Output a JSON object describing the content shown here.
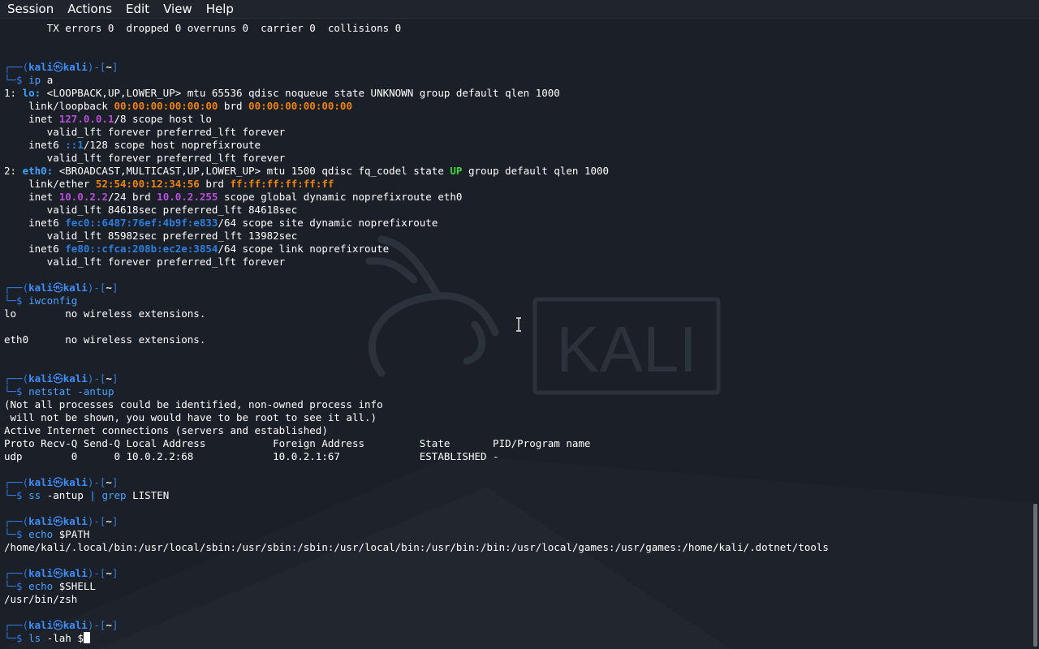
{
  "menubar": {
    "items": [
      "Session",
      "Actions",
      "Edit",
      "View",
      "Help"
    ]
  },
  "wallpaper": {
    "logo_text": "KALI"
  },
  "prompt": {
    "top": "┌──(",
    "user": "kali",
    "at": "㉿",
    "host": "kali",
    "mid": ")-[",
    "dir": "~",
    "end": "]",
    "bottom": "└─$ "
  },
  "colors": {
    "background": "#1b1f27",
    "prompt_blue": "#2f7de1",
    "interface": "#3fa3ff",
    "mac": "#f0820a",
    "ipv4": "#b74fd8",
    "ipv6": "#2b7fe0",
    "state_up": "#3fd53f"
  },
  "lines": [
    {
      "s": [
        {
          "c": "plain",
          "t": "       TX errors 0  dropped 0 overruns 0  carrier 0  collisions 0"
        }
      ]
    },
    {
      "s": []
    },
    {
      "s": []
    },
    {
      "p": "top"
    },
    {
      "p": "bottom",
      "s": [
        {
          "c": "cmd",
          "t": "ip"
        },
        {
          "c": "plain",
          "t": " a"
        }
      ]
    },
    {
      "s": [
        {
          "c": "plain",
          "t": "1: "
        },
        {
          "c": "if",
          "t": "lo:"
        },
        {
          "c": "plain",
          "t": " <LOOPBACK,UP,LOWER_UP> mtu 65536 qdisc noqueue state UNKNOWN group default qlen 1000"
        }
      ]
    },
    {
      "s": [
        {
          "c": "plain",
          "t": "    link/loopback "
        },
        {
          "c": "mac",
          "t": "00:00:00:00:00:00"
        },
        {
          "c": "plain",
          "t": " brd "
        },
        {
          "c": "mac",
          "t": "00:00:00:00:00:00"
        }
      ]
    },
    {
      "s": [
        {
          "c": "plain",
          "t": "    inet "
        },
        {
          "c": "ip4",
          "t": "127.0.0.1"
        },
        {
          "c": "plain",
          "t": "/8 scope host lo"
        }
      ]
    },
    {
      "s": [
        {
          "c": "plain",
          "t": "       valid_lft forever preferred_lft forever"
        }
      ]
    },
    {
      "s": [
        {
          "c": "plain",
          "t": "    inet6 "
        },
        {
          "c": "ip6",
          "t": "::1"
        },
        {
          "c": "plain",
          "t": "/128 scope host noprefixroute"
        }
      ]
    },
    {
      "s": [
        {
          "c": "plain",
          "t": "       valid_lft forever preferred_lft forever"
        }
      ]
    },
    {
      "s": [
        {
          "c": "plain",
          "t": "2: "
        },
        {
          "c": "if",
          "t": "eth0:"
        },
        {
          "c": "plain",
          "t": " <BROADCAST,MULTICAST,UP,LOWER_UP> mtu 1500 qdisc fq_codel state "
        },
        {
          "c": "up",
          "t": "UP"
        },
        {
          "c": "plain",
          "t": " group default qlen 1000"
        }
      ]
    },
    {
      "s": [
        {
          "c": "plain",
          "t": "    link/ether "
        },
        {
          "c": "mac",
          "t": "52:54:00:12:34:56"
        },
        {
          "c": "plain",
          "t": " brd "
        },
        {
          "c": "mac",
          "t": "ff:ff:ff:ff:ff:ff"
        }
      ]
    },
    {
      "s": [
        {
          "c": "plain",
          "t": "    inet "
        },
        {
          "c": "ip4",
          "t": "10.0.2.2"
        },
        {
          "c": "plain",
          "t": "/24 brd "
        },
        {
          "c": "ip4",
          "t": "10.0.2.255"
        },
        {
          "c": "plain",
          "t": " scope global dynamic noprefixroute eth0"
        }
      ]
    },
    {
      "s": [
        {
          "c": "plain",
          "t": "       valid_lft 84618sec preferred_lft 84618sec"
        }
      ]
    },
    {
      "s": [
        {
          "c": "plain",
          "t": "    inet6 "
        },
        {
          "c": "ip6",
          "t": "fec0::6487:76ef:4b9f:e833"
        },
        {
          "c": "plain",
          "t": "/64 scope site dynamic noprefixroute"
        }
      ]
    },
    {
      "s": [
        {
          "c": "plain",
          "t": "       valid_lft 85982sec preferred_lft 13982sec"
        }
      ]
    },
    {
      "s": [
        {
          "c": "plain",
          "t": "    inet6 "
        },
        {
          "c": "ip6",
          "t": "fe80::cfca:208b:ec2e:3854"
        },
        {
          "c": "plain",
          "t": "/64 scope link noprefixroute"
        }
      ]
    },
    {
      "s": [
        {
          "c": "plain",
          "t": "       valid_lft forever preferred_lft forever"
        }
      ]
    },
    {
      "s": []
    },
    {
      "p": "top"
    },
    {
      "p": "bottom",
      "s": [
        {
          "c": "cmd",
          "t": "iwconfig"
        }
      ]
    },
    {
      "s": [
        {
          "c": "plain",
          "t": "lo        no wireless extensions."
        }
      ]
    },
    {
      "s": []
    },
    {
      "s": [
        {
          "c": "plain",
          "t": "eth0      no wireless extensions."
        }
      ]
    },
    {
      "s": []
    },
    {
      "s": []
    },
    {
      "p": "top"
    },
    {
      "p": "bottom",
      "s": [
        {
          "c": "cmd",
          "t": "netstat"
        },
        {
          "c": "cmd",
          "t": " -antup"
        }
      ]
    },
    {
      "s": [
        {
          "c": "plain",
          "t": "(Not all processes could be identified, non-owned process info"
        }
      ]
    },
    {
      "s": [
        {
          "c": "plain",
          "t": " will not be shown, you would have to be root to see it all.)"
        }
      ]
    },
    {
      "s": [
        {
          "c": "plain",
          "t": "Active Internet connections (servers and established)"
        }
      ]
    },
    {
      "s": [
        {
          "c": "plain",
          "t": "Proto Recv-Q Send-Q Local Address           Foreign Address         State       PID/Program name"
        }
      ]
    },
    {
      "s": [
        {
          "c": "plain",
          "t": "udp        0      0 10.0.2.2:68             10.0.2.1:67             ESTABLISHED -"
        }
      ]
    },
    {
      "s": []
    },
    {
      "p": "top"
    },
    {
      "p": "bottom",
      "s": [
        {
          "c": "cmd",
          "t": "ss"
        },
        {
          "c": "plain",
          "t": " -antup "
        },
        {
          "c": "cmd",
          "t": "|"
        },
        {
          "c": "plain",
          "t": " "
        },
        {
          "c": "cmd",
          "t": "grep"
        },
        {
          "c": "plain",
          "t": " LISTEN"
        }
      ]
    },
    {
      "s": []
    },
    {
      "p": "top"
    },
    {
      "p": "bottom",
      "s": [
        {
          "c": "cmd",
          "t": "echo"
        },
        {
          "c": "plain",
          "t": " $PATH"
        }
      ]
    },
    {
      "s": [
        {
          "c": "path",
          "t": "/home/kali/.local/bin:/usr/local/sbin:/usr/sbin:/sbin:/usr/local/bin:/usr/bin:/bin:/usr/local/games:/usr/games:/home/kali/.dotnet/tools"
        }
      ]
    },
    {
      "s": []
    },
    {
      "p": "top"
    },
    {
      "p": "bottom",
      "s": [
        {
          "c": "cmd",
          "t": "echo"
        },
        {
          "c": "plain",
          "t": " $SHELL"
        }
      ]
    },
    {
      "s": [
        {
          "c": "plain",
          "t": "/usr/bin/zsh"
        }
      ]
    },
    {
      "s": []
    },
    {
      "p": "top"
    },
    {
      "p": "bottom",
      "cursor": true,
      "s": [
        {
          "c": "cmd",
          "t": "ls"
        },
        {
          "c": "plain",
          "t": " -lah $"
        }
      ]
    }
  ]
}
